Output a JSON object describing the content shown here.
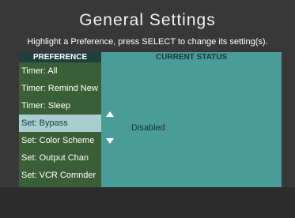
{
  "title": "General Settings",
  "hint": "Highlight a Preference, press SELECT to change its setting(s).",
  "columns": {
    "preference": "PREFERENCE",
    "current_status": "CURRENT STATUS"
  },
  "preferences": [
    {
      "label": "Timer: All"
    },
    {
      "label": "Timer: Remind New"
    },
    {
      "label": "Timer: Sleep"
    },
    {
      "label": "Set: Bypass"
    },
    {
      "label": "Set: Color Scheme"
    },
    {
      "label": "Set: Output Chan"
    },
    {
      "label": "Set: VCR Comnder"
    }
  ],
  "selected_index": 3,
  "current_status": "Disabled",
  "icons": {
    "scroll_up": "up-arrow-icon",
    "scroll_down": "down-arrow-icon"
  },
  "colors": {
    "background": "#383838",
    "preference_panel": "#3a5e35",
    "status_panel": "#4a9c98",
    "selection_highlight": "#a8cfcd"
  }
}
